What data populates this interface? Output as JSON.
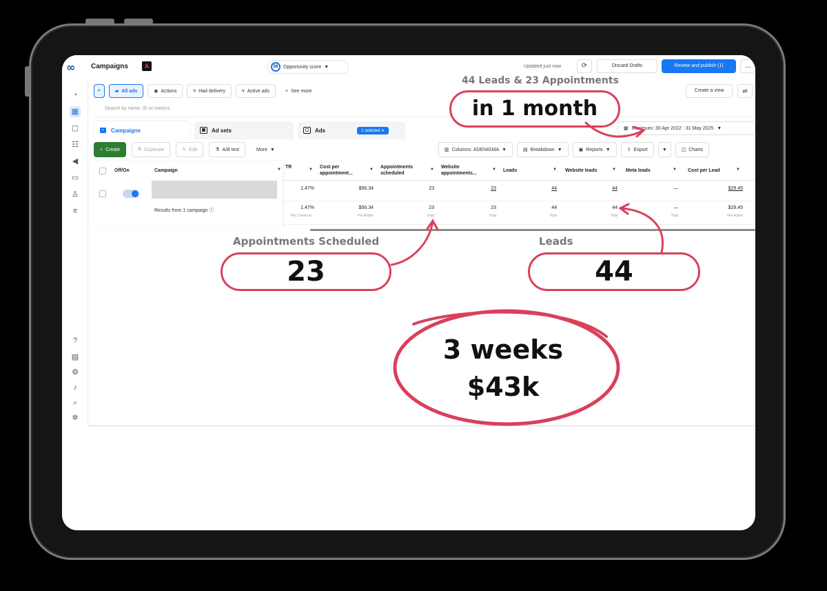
{
  "header": {
    "title": "Campaigns",
    "opportunity_score": "56",
    "opportunity_label": "Opportunity score",
    "updated": "Updated just now",
    "discard": "Discard Drafts",
    "publish": "Review and publish (1)"
  },
  "filters": {
    "all_ads": "All ads",
    "actions": "Actions",
    "had_delivery": "Had delivery",
    "active_ads": "Active ads",
    "see_more": "See more",
    "create_view": "Create a view"
  },
  "search": {
    "placeholder": "Search by name, ID or metrics"
  },
  "tabs": {
    "campaigns": "Campaigns",
    "ad_sets": "Ad sets",
    "ads": "Ads",
    "selected": "1 selected"
  },
  "date_range": "Maximum: 30 Apr 2022 - 31 May 2025",
  "toolbar": {
    "create": "Create",
    "duplicate": "Duplicate",
    "edit": "Edit",
    "ab_test": "A/B test",
    "more": "More",
    "columns": "Columns: ADENIGMA",
    "breakdown": "Breakdown",
    "reports": "Reports",
    "export": "Export",
    "charts": "Charts"
  },
  "table": {
    "headers": {
      "offon": "Off/On",
      "campaign": "Campaign",
      "ctr": "TR",
      "cost_per_appt": "Cost per appointment...",
      "appts_scheduled": "Appointments scheduled",
      "website_appts": "Website appointments...",
      "leads": "Leads",
      "website_leads": "Website leads",
      "meta_leads": "Meta leads",
      "cost_per_lead": "Cost per Lead"
    },
    "row": {
      "ctr": "1.47%",
      "cost_per_appt": "$56.34",
      "appts_scheduled": "23",
      "website_appts": "23",
      "leads": "44",
      "website_leads": "44",
      "meta_leads": "—",
      "cost_per_lead": "$29.45"
    },
    "total": {
      "ctr": "1.47%",
      "ctr_sub": "Per Centre ar...",
      "cost_per_appt": "$56.34",
      "cost_per_appt_sub": "Per Action",
      "appts_scheduled": "23",
      "appts_sub": "Total",
      "website_appts": "23",
      "website_appts_sub": "Total",
      "leads": "44",
      "leads_sub": "Total",
      "website_leads": "44",
      "website_leads_sub": "Total",
      "meta_leads": "—",
      "meta_leads_sub": "Total",
      "cost_per_lead": "$29.45",
      "cost_per_lead_sub": "Per Action"
    },
    "results": "Results from 1 campaign"
  },
  "annotations": {
    "headline": "44 Leads & 23 Appointments",
    "month": "in 1 month",
    "appt_label": "Appointments Scheduled",
    "appt_value": "23",
    "leads_label": "Leads",
    "leads_value": "44",
    "weeks": "3 weeks",
    "amount": "$43k"
  },
  "colors": {
    "accent": "#1877f2",
    "annotation": "#d9405a",
    "create_green": "#2e7d32"
  }
}
